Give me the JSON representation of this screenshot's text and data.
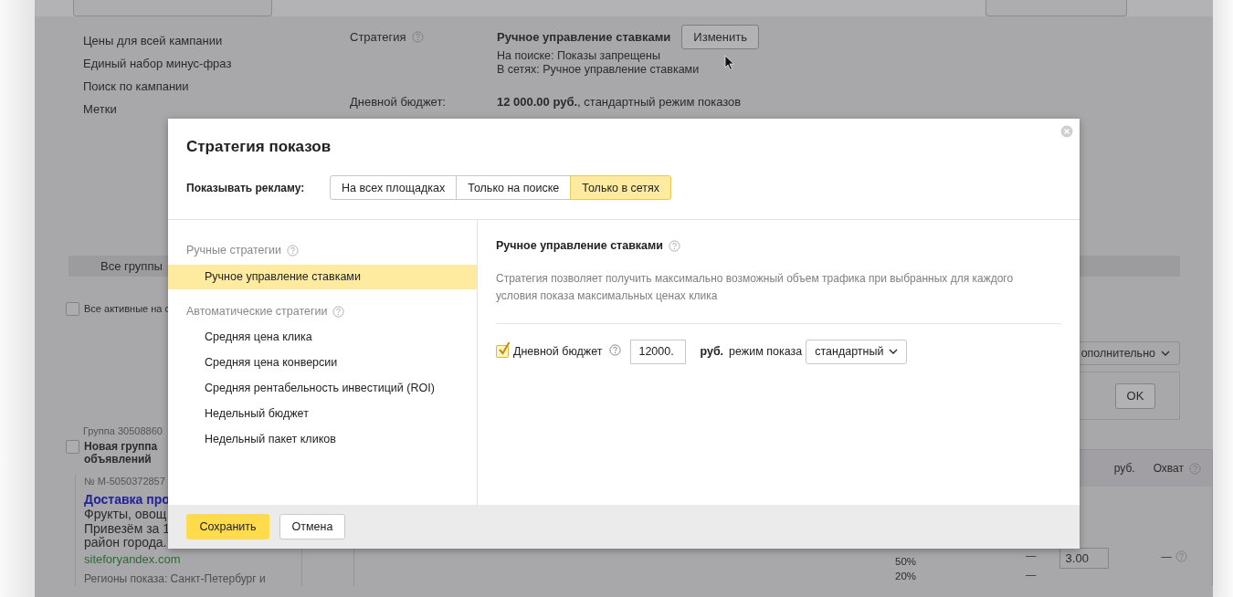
{
  "page": {
    "side_links": [
      "Цены для всей кампании",
      "Единый набор минус-фраз",
      "Поиск по кампании",
      "Метки"
    ],
    "strategy": {
      "label": "Стратегия",
      "value": "Ручное управление ставками",
      "button": "Изменить",
      "details": [
        "На поиске: Показы запрещены",
        "В сетях: Ручное управление ставками"
      ]
    },
    "daily_budget": {
      "label": "Дневной бюджет:",
      "value": "**12 000.00 руб.**, стандартный режим показов"
    },
    "groups_tab": "Все группы",
    "select_all": {
      "label": "Все активные на с",
      "checked": false
    },
    "more_dropdown": "ополнительно",
    "ok_button": "OK",
    "group": {
      "id": "Группа 30508860",
      "checked": false,
      "name": "Новая группа объявлений",
      "number": "№ M-5050372857",
      "ad_title": "Доставка про",
      "ad_text": [
        "Фрукты, овощ",
        "Привезём за 1",
        "район города."
      ],
      "url": "siteforyandex.com",
      "regions": "Регионы показа: Санкт-Петербург и"
    },
    "table": {
      "columns": [
        "руб.",
        "Охват"
      ],
      "reach": [
        "50%",
        "20%"
      ],
      "bids": [
        "—",
        "—"
      ],
      "bid_value": "3.00",
      "coverage": "—"
    }
  },
  "dialog": {
    "title": "Стратегия показов",
    "show_ads": {
      "label": "Показывать рекламу:",
      "options": [
        {
          "label": "На всех площадках",
          "selected": false
        },
        {
          "label": "Только на поиске",
          "selected": false
        },
        {
          "label": "Только в сетях",
          "selected": true
        }
      ]
    },
    "strategy_groups": [
      {
        "title": "Ручные стратегии",
        "items": [
          {
            "label": "Ручное управление ставками",
            "selected": true
          }
        ]
      },
      {
        "title": "Автоматические стратегии",
        "items": [
          {
            "label": "Средняя цена клика",
            "selected": false
          },
          {
            "label": "Средняя цена конверсии",
            "selected": false
          },
          {
            "label": "Средняя рентабельность инвестиций (ROI)",
            "selected": false
          },
          {
            "label": "Недельный бюджет",
            "selected": false
          },
          {
            "label": "Недельный пакет кликов",
            "selected": false
          }
        ]
      }
    ],
    "detail": {
      "title": "Ручное управление ставками",
      "description": "Стратегия позволяет получить максимально возможный объем трафика при выбранных для каждого условия показа максимальных ценах клика",
      "budget": {
        "checked": true,
        "label": "Дневной бюджет",
        "value": "12000.",
        "unit": "руб.",
        "mode_label": "режим показа",
        "mode": "стандартный"
      }
    },
    "buttons": {
      "save": "Сохранить",
      "cancel": "Отмена"
    }
  }
}
